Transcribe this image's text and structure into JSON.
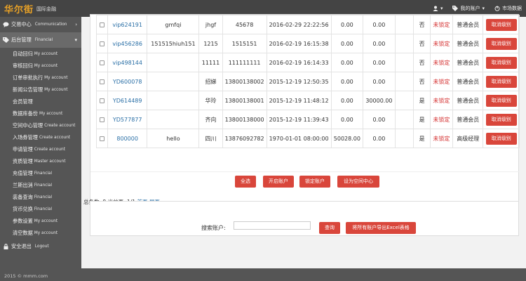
{
  "header": {
    "logo": "华尔街",
    "logo_sub": "国际金融",
    "user_menu": "",
    "account_menu": "我的账户",
    "market_link": "市场数据"
  },
  "sidebar": {
    "items": [
      {
        "label": "交易中心",
        "en": "Communication",
        "type": "main"
      },
      {
        "label": "后台管理",
        "en": "Financial",
        "type": "main",
        "active": true
      },
      {
        "label": "自动回归",
        "en": "My account"
      },
      {
        "label": "审核回归",
        "en": "My account"
      },
      {
        "label": "订单审批执行",
        "en": "My account"
      },
      {
        "label": "新闻公告管理",
        "en": "My account"
      },
      {
        "label": "会员管理",
        "en": ""
      },
      {
        "label": "数据库备份",
        "en": "My account"
      },
      {
        "label": "空间中心管理",
        "en": "Create account"
      },
      {
        "label": "入场券管理",
        "en": "Create account"
      },
      {
        "label": "申请管理",
        "en": "Create account"
      },
      {
        "label": "资质管理",
        "en": "Master account"
      },
      {
        "label": "充值管理",
        "en": "Financial"
      },
      {
        "label": "兰斯出消",
        "en": "Financial"
      },
      {
        "label": "装备查询",
        "en": "Financial"
      },
      {
        "label": "货币兑换",
        "en": "Financial"
      },
      {
        "label": "参数设置",
        "en": "My account"
      },
      {
        "label": "清空数据",
        "en": "My account"
      },
      {
        "label": "安全退出",
        "en": "Logout",
        "type": "main"
      }
    ]
  },
  "table": {
    "rows": [
      {
        "account": "vip624191",
        "name": "gmfqi",
        "city": "jhgf",
        "phone": "45678",
        "time": "2016-02-29 22:22:56",
        "v1": "0.00",
        "v2": "0.00",
        "flag": "否",
        "lock": "未锁定",
        "level": "普通会员",
        "action": "取消级别"
      },
      {
        "account": "vip456286",
        "name": "151515hiuh151",
        "city": "1215",
        "phone": "1515151",
        "time": "2016-02-19 16:15:38",
        "v1": "0.00",
        "v2": "0.00",
        "flag": "否",
        "lock": "未锁定",
        "level": "普通会员",
        "action": "取消级别"
      },
      {
        "account": "vip498144",
        "name": "",
        "city": "11111",
        "phone": "111111111",
        "time": "2016-02-19 16:14:33",
        "v1": "0.00",
        "v2": "0.00",
        "flag": "否",
        "lock": "未锁定",
        "level": "普通会员",
        "action": "取消级别"
      },
      {
        "account": "YD600078",
        "name": "",
        "city": "招娣",
        "phone": "13800138002",
        "time": "2015-12-19 12:50:35",
        "v1": "0.00",
        "v2": "0.00",
        "flag": "否",
        "lock": "未锁定",
        "level": "普通会员",
        "action": "取消级别"
      },
      {
        "account": "YD614489",
        "name": "",
        "city": "华玲",
        "phone": "13800138001",
        "time": "2015-12-19 11:48:12",
        "v1": "0.00",
        "v2": "30000.00",
        "flag": "是",
        "lock": "未锁定",
        "level": "普通会员",
        "action": "取消级别"
      },
      {
        "account": "YD577877",
        "name": "",
        "city": "齐向",
        "phone": "13800138000",
        "time": "2015-12-19 11:39:43",
        "v1": "0.00",
        "v2": "0.00",
        "flag": "是",
        "lock": "未锁定",
        "level": "普通会员",
        "action": "取消级别"
      },
      {
        "account": "800000",
        "name": "hello",
        "city": "四川",
        "phone": "13876092782",
        "time": "1970-01-01 08:00:00",
        "v1": "50028.00",
        "v2": "0.00",
        "flag": "是",
        "lock": "未锁定",
        "level": "高级经理",
        "action": "取消级别"
      }
    ]
  },
  "actions": {
    "select_all": "全选",
    "open_account": "开启账户",
    "lock_account": "锁定账户",
    "set_center": "设为空间中心"
  },
  "summary": {
    "text": "总条数: 8 当前页: 1/1",
    "first": "首页",
    "last": "尾页"
  },
  "search": {
    "label": "搜索账户:",
    "value": "",
    "query_button": "查询",
    "export_button": "将所有账户导出Excel表格"
  },
  "footer": {
    "copyright": "2015 © mmm.com"
  },
  "colors": {
    "accent": "#d9463b",
    "sidebar": "#555555",
    "topbar": "#444444",
    "link": "#2a6fa6",
    "logo": "#e8a126"
  }
}
